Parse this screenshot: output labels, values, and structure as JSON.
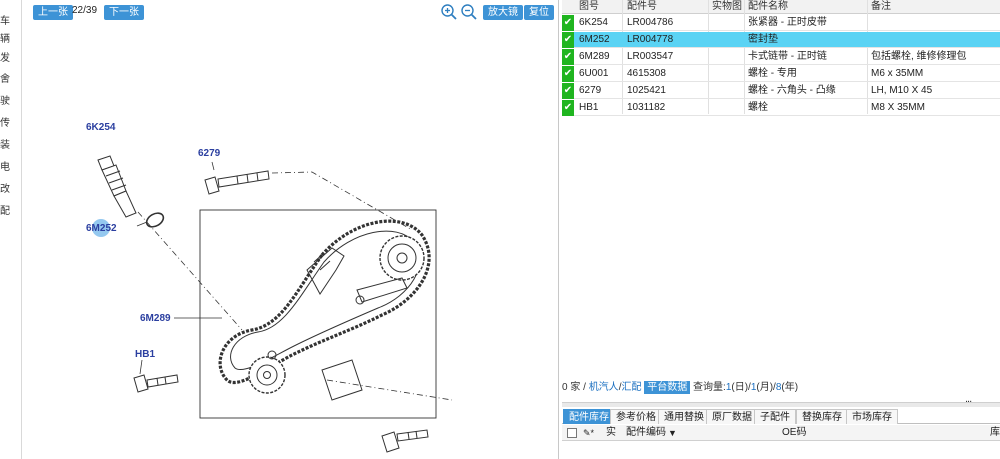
{
  "left_strip": {
    "chars": [
      "车",
      "辆",
      "发",
      "舍",
      "驶",
      "传",
      "装",
      "电",
      "改",
      "配"
    ]
  },
  "toolbar": {
    "prev_label": "上一张",
    "page_indicator": "22/39",
    "next_label": "下一张",
    "zoom_in_icon": "zoom-in-icon",
    "zoom_out_icon": "zoom-out-icon",
    "enlarge_label": "放大镜",
    "reset_label": "复位"
  },
  "diagram": {
    "callouts": [
      {
        "id": "6K254",
        "label": "6K254"
      },
      {
        "id": "6279",
        "label": "6279"
      },
      {
        "id": "6M252",
        "label": "6M252"
      },
      {
        "id": "6M289",
        "label": "6M289"
      },
      {
        "id": "HB1",
        "label": "HB1"
      }
    ],
    "highlight_color": "#5aaae6",
    "callout_color": "#2b3fa0"
  },
  "parts_table": {
    "headers": [
      "图号",
      "配件号",
      "实物图",
      "配件名称",
      "备注"
    ],
    "rows": [
      {
        "code": "6K254",
        "part_no": "LR004786",
        "name": "张紧器 - 正时皮带",
        "note": "",
        "selected": false
      },
      {
        "code": "6M252",
        "part_no": "LR004778",
        "name": "密封垫",
        "note": "",
        "selected": true
      },
      {
        "code": "6M289",
        "part_no": "LR003547",
        "name": "卡式链带 - 正时链",
        "note": "包括螺栓, 维修修理包",
        "selected": false
      },
      {
        "code": "6U001",
        "part_no": "4615308",
        "name": "螺栓 - 专用",
        "note": "M6 x 35MM",
        "selected": false
      },
      {
        "code": "6279",
        "part_no": "1025421",
        "name": "螺栓 - 六角头 - 凸缘",
        "note": "LH, M10 X 45",
        "selected": false
      },
      {
        "code": "HB1",
        "part_no": "1031182",
        "name": "螺栓",
        "note": "M8 X 35MM",
        "selected": false
      }
    ],
    "check_color": "#1fb51f",
    "selected_color": "#5ad3f4"
  },
  "status": {
    "prefix": "0 家 /",
    "link1": "机汽人",
    "sep1": "/",
    "link2": "汇配",
    "platform_label": "平台数据",
    "query_label": "查询量:",
    "q1": "1",
    "u1": "(日)/",
    "q2": "1",
    "u2": "(月)/",
    "q3": "8",
    "u3": "(年)",
    "more": "..."
  },
  "tabs": [
    {
      "label": "配件库存",
      "active": true
    },
    {
      "label": "参考价格",
      "active": false
    },
    {
      "label": "通用替换",
      "active": false
    },
    {
      "label": "原厂数据",
      "active": false
    },
    {
      "label": "子配件",
      "active": false
    },
    {
      "label": "替换库存",
      "active": false
    },
    {
      "label": "市场库存",
      "active": false
    }
  ],
  "inventory_header": {
    "col_actual": "实",
    "col_code": "配件编码",
    "filter_icon": "filter-icon",
    "col_oe": "OE码",
    "col_end": "库"
  },
  "accent": "#3d93d6"
}
